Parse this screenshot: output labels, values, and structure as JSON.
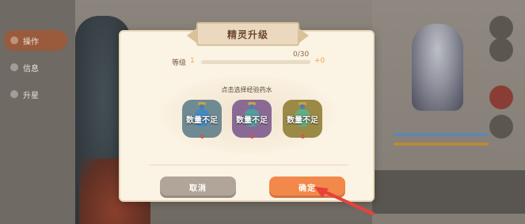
{
  "background": {
    "sidebar_items": [
      {
        "label": "操作",
        "active": true
      },
      {
        "label": "信息",
        "active": false
      },
      {
        "label": "升星",
        "active": false
      }
    ]
  },
  "dialog": {
    "title": "精灵升级",
    "level_label": "等级",
    "current_level": "1",
    "exp_progress_text": "0/30",
    "exp_progress_fraction": 0,
    "level_gain": "+0",
    "prompt": "点击选择经验药水",
    "potions": [
      {
        "status_text": "数量不足",
        "count": "0",
        "color": "#6f8a93"
      },
      {
        "status_text": "数量不足",
        "count": "0",
        "color": "#8a6a94"
      },
      {
        "status_text": "数量不足",
        "count": "0",
        "color": "#9a8a45"
      }
    ],
    "cancel_label": "取消",
    "confirm_label": "确定"
  },
  "colors": {
    "accent_orange": "#f2894a",
    "level_highlight": "#f1a53a",
    "count_red": "#e24b3b",
    "cancel_gray": "#b0a598"
  }
}
